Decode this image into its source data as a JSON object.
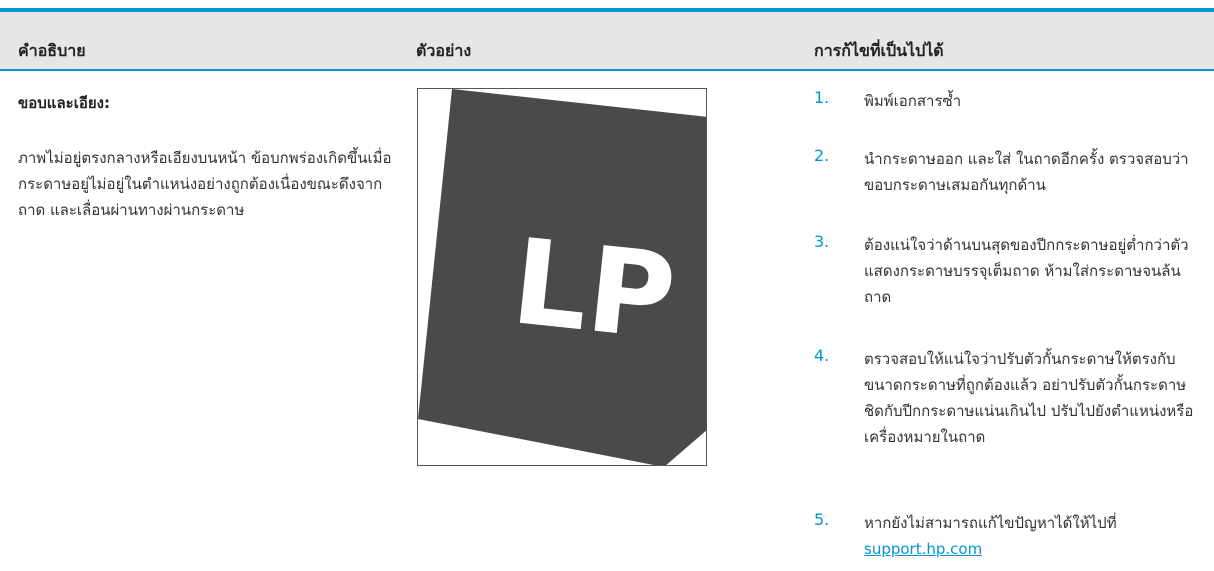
{
  "header": {
    "col1": "คำอธิบาย",
    "col2": "ตัวอย่าง",
    "col3": "การก้ไขที่เป็นไปได้"
  },
  "row": {
    "title": "ขอบและเอียง:",
    "description": "ภาพไม่อยู่ตรงกลางหรือเอียงบนหน้า ข้อบกพร่องเกิดขึ้นเมื่อกระดาษอยู่ไม่อยู่ในตำแหน่งอย่างถูกต้องเนื่องขณะดึงจากถาด และเลื่อนผ่านทางผ่านกระดาษ",
    "sample_text": "LP",
    "steps": [
      {
        "num": "1.",
        "text": "พิมพ์เอกสารซ้ำ"
      },
      {
        "num": "2.",
        "text": "นำกระดาษออก และใส่ ในถาดอีกครั้ง ตรวจสอบว่าขอบกระดาษเสมอกันทุกด้าน"
      },
      {
        "num": "3.",
        "text": "ต้องแน่ใจว่าด้านบนสุดของปีกกระดาษอยู่ต่ำกว่าตัวแสดงกระดาษบรรจุเต็มถาด ห้ามใส่กระดาษจนล้นถาด"
      },
      {
        "num": "4.",
        "text": "ตรวจสอบให้แน่ใจว่าปรับตัวกั้นกระดาษให้ตรงกับขนาดกระดาษที่ถูกต้องแล้ว อย่าปรับตัวกั้นกระดาษชิดกับปีกกระดาษแน่นเกินไป ปรับไปยังตำแหน่งหรือเครื่องหมายในถาด"
      },
      {
        "num": "5.",
        "text": "หากยังไม่สามารถแก้ไขปัญหาได้ให้ไปที่",
        "link": "support.hp.com"
      }
    ]
  },
  "colors": {
    "accent": "#0096d6",
    "header_bg": "#e6e6e6",
    "sample_fill": "#4a4a4a"
  }
}
